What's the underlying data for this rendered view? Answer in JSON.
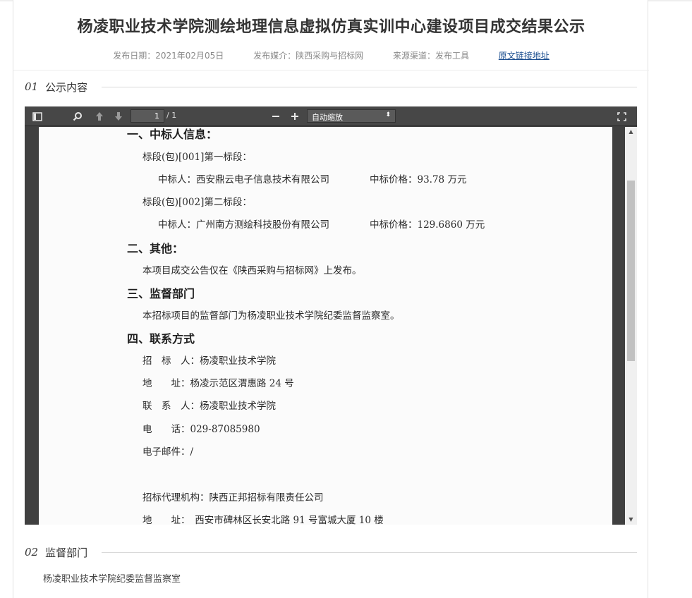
{
  "header": {
    "title": "杨凌职业技术学院测绘地理信息虚拟仿真实训中心建设项目成交结果公示",
    "publish_date": "发布日期：2021年02月05日",
    "media": "发布媒介：陕西采购与招标网",
    "source": "来源渠道：发布工具",
    "origin_link": "原文链接地址"
  },
  "section1": {
    "num": "01",
    "title": "公示内容"
  },
  "viewer": {
    "toolbar": {
      "page_current": "1",
      "page_total": "/ 1",
      "zoom_select": "自动缩放",
      "zoom_caret": "⬍"
    },
    "document": {
      "heading1": "一、中标人信息：",
      "lot1": "标段(包)[001]第一标段：",
      "lot1_winner": "中标人：西安鼎云电子信息技术有限公司",
      "lot1_price": "中标价格：93.78 万元",
      "lot2": "标段(包)[002]第二标段：",
      "lot2_winner": "中标人：广州南方测绘科技股份有限公司",
      "lot2_price": "中标价格：129.6860 万元",
      "heading2": "二、其他：",
      "other": "本项目成交公告仅在《陕西采购与招标网》上发布。",
      "heading3": "三、监督部门",
      "supervision": "本招标项目的监督部门为杨凌职业技术学院纪委监督监察室。",
      "heading4": "四、联系方式",
      "tenderer": "招　标　人：杨凌职业技术学院",
      "address": "地　　址：杨凌示范区渭惠路 24 号",
      "contact": "联　系　人：杨凌职业技术学院",
      "phone": "电　　话：029-87085980",
      "email": "电子邮件：/",
      "agency": "招标代理机构：陕西正邦招标有限责任公司",
      "agency_address": "地　　址：　西安市碑林区长安北路  91  号富城大厦  10  楼"
    },
    "scrollbar": {
      "position_fraction": 0.22
    }
  },
  "section2": {
    "num": "02",
    "title": "监督部门",
    "content": "杨凌职业技术学院纪委监督监察室"
  },
  "colors": {
    "link": "#1a4d8f",
    "viewer_toolbar": "#474747",
    "viewer_bg": "#404040"
  }
}
